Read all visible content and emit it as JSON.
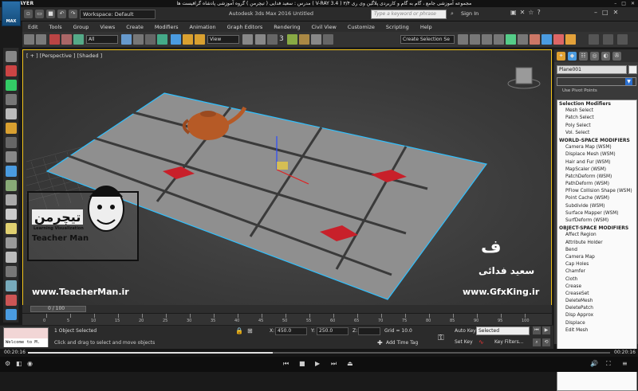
{
  "player": {
    "logo": "KMPLAYER",
    "video_title": "مجموعه آموزشی جامع ، گام به گام و کاربردی پلاگین وی ری ۳/۴ ( V-RAY 3.4 ) مدرس : سعید فدایی ( تیچرمن ) گروه آموزشی پادشاه گرافیست ها",
    "time_elapsed": "00:20:16",
    "time_total": "00:20:16",
    "progress": 0.42
  },
  "app": {
    "logo": "MAX",
    "workspace": "Workspace: Default",
    "title": "Autodesk 3ds Max 2016     Untitled",
    "search_placeholder": "Type a keyword or phrase",
    "sign_in": "Sign In"
  },
  "menu": [
    "Edit",
    "Tools",
    "Group",
    "Views",
    "Create",
    "Modifiers",
    "Animation",
    "Graph Editors",
    "Rendering",
    "Civil View",
    "Customize",
    "Scripting",
    "Help"
  ],
  "toolbar": {
    "filter": "All",
    "view": "View",
    "snap_label": "3",
    "selection_set": "Create Selection Se"
  },
  "viewport": {
    "label": "[ + ] [Perspective ] [Shaded ]"
  },
  "command_panel": {
    "object_name": "Plane001",
    "pivot_label": "Use Pivot Points",
    "modifiers": [
      {
        "header": true,
        "label": "Selection Modifiers"
      },
      {
        "label": "Mesh Select"
      },
      {
        "label": "Patch Select"
      },
      {
        "label": "Poly Select"
      },
      {
        "label": "Vol. Select"
      },
      {
        "header": true,
        "label": "WORLD-SPACE MODIFIERS"
      },
      {
        "label": "Camera Map (WSM)"
      },
      {
        "label": "Displace Mesh (WSM)"
      },
      {
        "label": "Hair and Fur (WSM)"
      },
      {
        "label": "MapScaler (WSM)"
      },
      {
        "label": "PatchDeform (WSM)"
      },
      {
        "label": "PathDeform (WSM)"
      },
      {
        "label": "PFlow Collision Shape (WSM)"
      },
      {
        "label": "Point Cache (WSM)"
      },
      {
        "label": "Subdivide (WSM)"
      },
      {
        "label": "Surface Mapper (WSM)"
      },
      {
        "label": "SurfDeform (WSM)"
      },
      {
        "header": true,
        "label": "OBJECT-SPACE MODIFIERS"
      },
      {
        "label": "Affect Region"
      },
      {
        "label": "Attribute Holder"
      },
      {
        "label": "Bend"
      },
      {
        "label": "Camera Map"
      },
      {
        "label": "Cap Holes"
      },
      {
        "label": "Chamfer"
      },
      {
        "label": "Cloth"
      },
      {
        "label": "Crease"
      },
      {
        "label": "CreaseSet"
      },
      {
        "label": "DeleteMesh"
      },
      {
        "label": "DeletePatch"
      },
      {
        "label": "Disp Approx"
      },
      {
        "label": "Displace"
      },
      {
        "label": "Edit Mesh"
      }
    ]
  },
  "timeline": {
    "frame": "0 / 100",
    "ticks": [
      "0",
      "5",
      "10",
      "15",
      "20",
      "25",
      "30",
      "35",
      "40",
      "45",
      "50",
      "55",
      "60",
      "65",
      "70",
      "75",
      "80",
      "85",
      "90",
      "95",
      "100"
    ]
  },
  "status": {
    "maxscript_line": "Welcome to M.",
    "selected": "1 Object Selected",
    "prompt": "Click and drag to select and move objects",
    "x_label": "X:",
    "x_value": "450.0",
    "y_label": "Y:",
    "y_value": "250.0",
    "z_label": "Z:",
    "z_value": "",
    "grid": "Grid = 10.0",
    "add_time_tag": "Add Time Tag",
    "auto_key": "Auto Key",
    "selected_mode": "Selected",
    "set_key": "Set Key",
    "key_filters": "Key Filters..."
  },
  "watermarks": {
    "teacher_logo_fa": "تیچرمن",
    "teacher_logo_sub": "Learning Visualization",
    "teacher_name": "Teacher Man",
    "teacher_url": "www.TeacherMan.ir",
    "author_fa": "سعید فدائی",
    "gfx_url": "www.GfxKing.ir"
  }
}
